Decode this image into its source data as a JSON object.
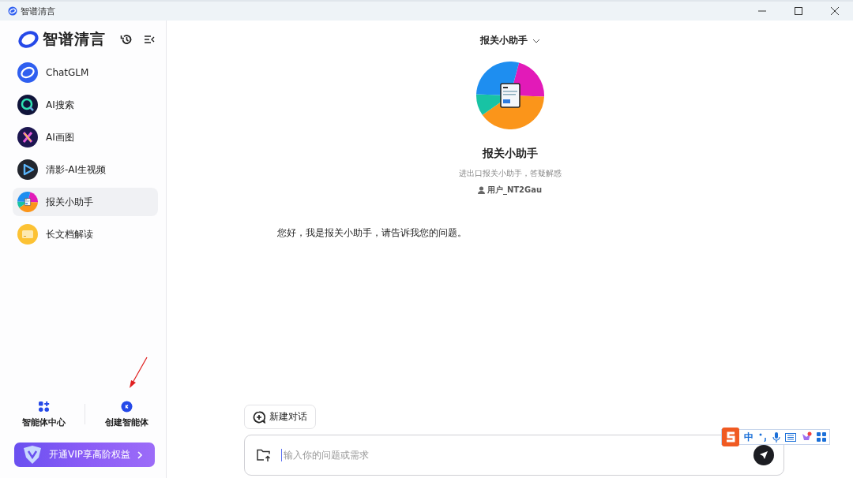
{
  "window": {
    "title": "智谱清言"
  },
  "sidebar": {
    "brand": "智谱清言",
    "items": [
      {
        "label": "ChatGLM",
        "selected": false
      },
      {
        "label": "AI搜索",
        "selected": false
      },
      {
        "label": "AI画图",
        "selected": false
      },
      {
        "label": "清影-AI生视频",
        "selected": false
      },
      {
        "label": "报关小助手",
        "selected": true
      },
      {
        "label": "长文档解读",
        "selected": false
      }
    ],
    "footer_actions": [
      "智能体中心",
      "创建智能体"
    ],
    "vip_banner": {
      "label": "开通VIP享高阶权益"
    }
  },
  "chat": {
    "agent_selector": "报关小助手",
    "agent": {
      "name": "报关小助手",
      "description": "进出口报关小助手，答疑解惑",
      "author": "用户_NT2Gau"
    },
    "messages": [
      "您好，我是报关小助手，请告诉我您的问题。"
    ],
    "new_chat_button": "新建对话",
    "input": {
      "placeholder": "输入你的问题或需求"
    }
  },
  "ime_toolbar": {
    "mode": "中"
  }
}
